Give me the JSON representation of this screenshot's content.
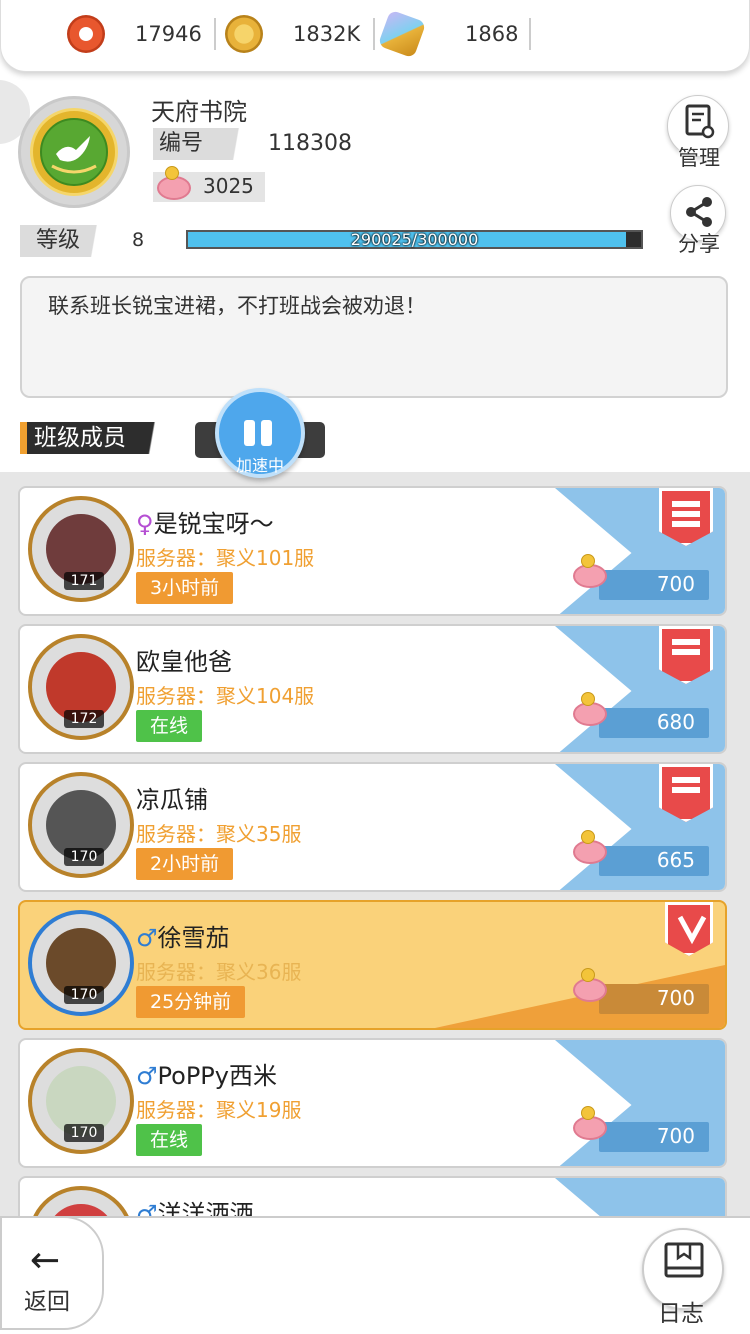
{
  "currencies": [
    {
      "name": "ticket-icon",
      "value": "17946",
      "color": "#e8572e"
    },
    {
      "name": "gold-coin-icon",
      "value": "1832K",
      "color": "#e8b23a"
    },
    {
      "name": "crystal-key-icon",
      "value": "1868",
      "color": "#9a7be0"
    }
  ],
  "guild": {
    "name": "天府书院",
    "id_label": "编号",
    "id": "118308",
    "funds": "3025",
    "level_label": "等级",
    "level": "8",
    "xp_text": "290025/300000",
    "xp_fraction": 0.9668,
    "notice": "联系班长锐宝进裙，不打班战会被劝退！"
  },
  "side_buttons": {
    "manage": "管理",
    "share": "分享"
  },
  "members_header": "班级成员",
  "speed": {
    "status": "加速中"
  },
  "members": [
    {
      "sex": "♀",
      "name": "是锐宝呀～",
      "server": "服务器：聚义101服",
      "status": "3小时前",
      "status_type": "ago",
      "level": "171",
      "contribution": "700",
      "rank": "leader",
      "highlight": false,
      "avatar_color": "#6f3c3c"
    },
    {
      "sex": "",
      "name": "欧皇他爸",
      "server": "服务器：聚义104服",
      "status": "在线",
      "status_type": "online",
      "level": "172",
      "contribution": "680",
      "rank": "officer",
      "highlight": false,
      "avatar_color": "#c0392b"
    },
    {
      "sex": "",
      "name": "凉瓜铺",
      "server": "服务器：聚义35服",
      "status": "2小时前",
      "status_type": "ago",
      "level": "170",
      "contribution": "665",
      "rank": "officer",
      "highlight": false,
      "avatar_color": "#555555"
    },
    {
      "sex": "♂",
      "name": "徐雪茄",
      "server": "服务器：聚义36服",
      "status": "25分钟前",
      "status_type": "ago",
      "level": "170",
      "contribution": "700",
      "rank": "elite",
      "highlight": true,
      "avatar_color": "#6b4a2a"
    },
    {
      "sex": "♂",
      "name": "PoPPy西米",
      "server": "服务器：聚义19服",
      "status": "在线",
      "status_type": "online",
      "level": "170",
      "contribution": "700",
      "rank": "",
      "highlight": false,
      "avatar_color": "#c9d7c0"
    },
    {
      "sex": "♂",
      "name": "洋洋洒洒",
      "server": "",
      "status": "",
      "status_type": "",
      "level": "",
      "contribution": "",
      "rank": "",
      "highlight": false,
      "avatar_color": "#d04040"
    }
  ],
  "bottom": {
    "back": "返回",
    "log": "日志",
    "back_arrow": "←"
  }
}
